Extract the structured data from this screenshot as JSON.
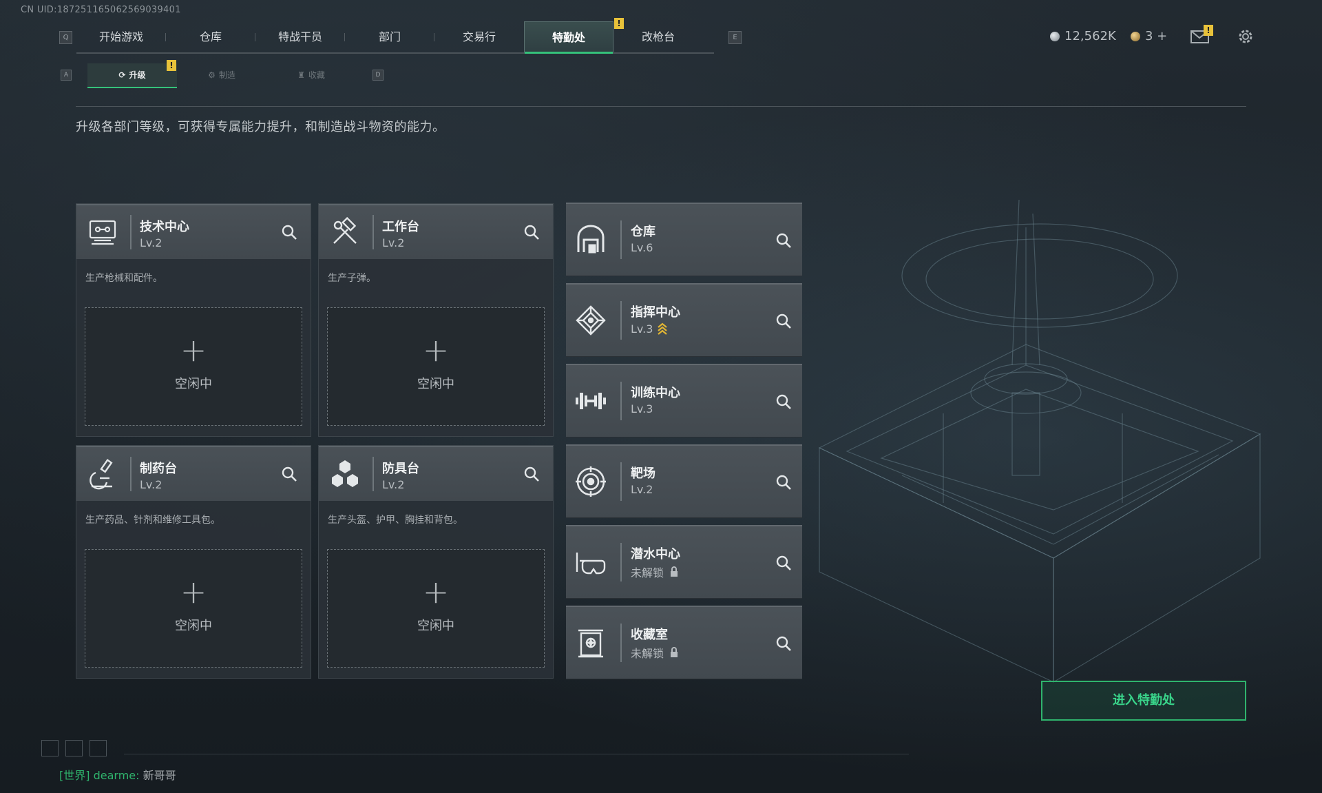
{
  "uid": "CN UID:18725116506256903940​1",
  "main_nav": {
    "left_key": "Q",
    "right_key": "E",
    "tabs": [
      {
        "label": "开始游戏",
        "active": false
      },
      {
        "label": "仓库",
        "active": false
      },
      {
        "label": "特战干员",
        "active": false
      },
      {
        "label": "部门",
        "active": false
      },
      {
        "label": "交易行",
        "active": false
      },
      {
        "label": "特勤处",
        "active": true
      },
      {
        "label": "改枪台",
        "active": false
      }
    ],
    "alert_mark": "!"
  },
  "resources": {
    "currency": "12,562K",
    "tokens": "3 +"
  },
  "sub_nav": {
    "left_key": "A",
    "right_key": "D",
    "tabs": [
      {
        "label": "升级",
        "active": true
      },
      {
        "label": "制造",
        "active": false
      },
      {
        "label": "收藏",
        "active": false
      }
    ]
  },
  "description": "升级各部门等级，可获得专属能力提升，和制造战斗物资的能力。",
  "workshops": [
    {
      "name": "技术中心",
      "level": "Lv.2",
      "desc": "生产枪械和配件。",
      "slot_status": "空闲中",
      "icon": "tech-center-icon"
    },
    {
      "name": "工作台",
      "level": "Lv.2",
      "desc": "生产子弹。",
      "slot_status": "空闲中",
      "icon": "hammer-wrench-icon"
    },
    {
      "name": "制药台",
      "level": "Lv.2",
      "desc": "生产药品、针剂和维修工具包。",
      "slot_status": "空闲中",
      "icon": "microscope-icon"
    },
    {
      "name": "防具台",
      "level": "Lv.2",
      "desc": "生产头盔、护甲、胸挂和背包。",
      "slot_status": "空闲中",
      "icon": "armor-boxes-icon"
    }
  ],
  "slot_plus": "+",
  "facilities": [
    {
      "name": "仓库",
      "level": "Lv.6",
      "icon": "warehouse-icon"
    },
    {
      "name": "指挥中心",
      "level": "Lv.3",
      "icon": "command-center-icon",
      "upgradable": true
    },
    {
      "name": "训练中心",
      "level": "Lv.3",
      "icon": "dumbbell-icon"
    },
    {
      "name": "靶场",
      "level": "Lv.2",
      "icon": "target-icon"
    },
    {
      "name": "潜水中心",
      "level": "未解锁",
      "icon": "diving-mask-icon",
      "locked": true
    },
    {
      "name": "收藏室",
      "level": "未解锁",
      "icon": "collection-icon",
      "locked": true
    }
  ],
  "enter_button": "进入特勤处",
  "chat": {
    "channel": "[世界]",
    "user": "dearme:",
    "message": "新哥哥"
  },
  "colors": {
    "accent_green": "#35c27a",
    "warning_yellow": "#e8c23a",
    "upgrade_gold": "#e0b534"
  }
}
